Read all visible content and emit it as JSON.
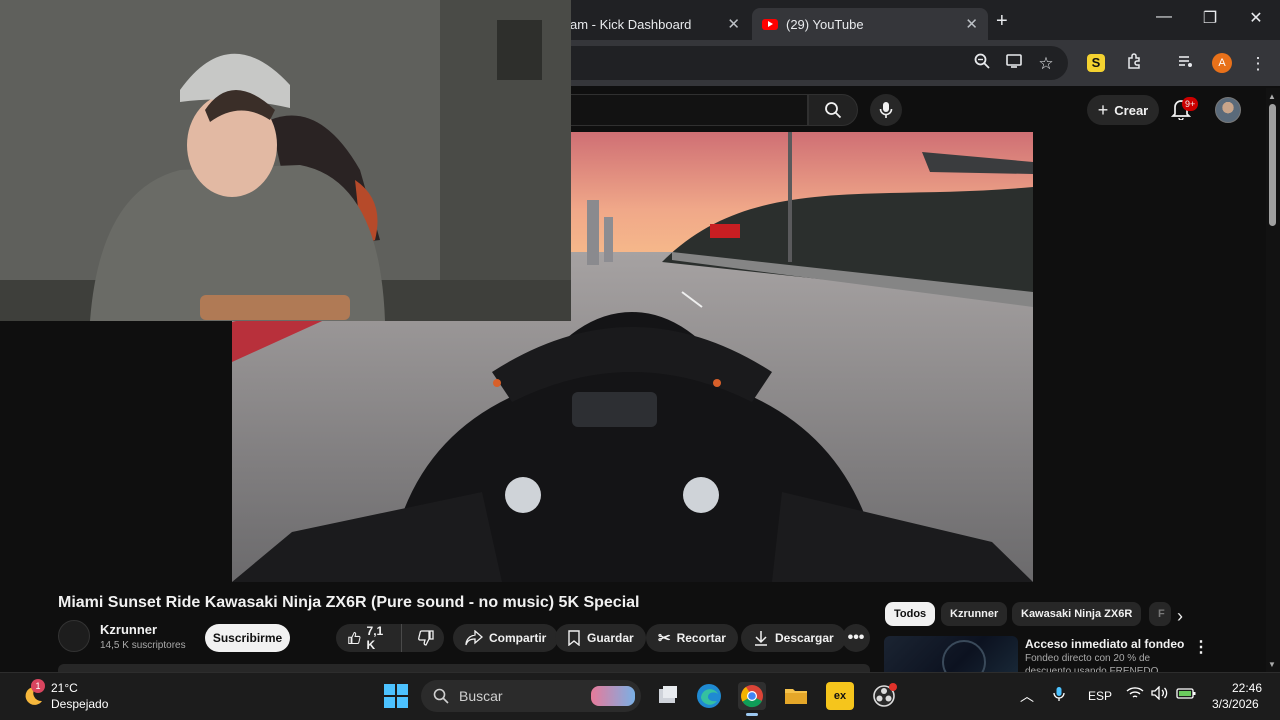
{
  "browser": {
    "tabs": [
      {
        "label": "am - Kick Dashboard"
      },
      {
        "label": "(29) YouTube"
      }
    ],
    "new_tab_icon": "plus-icon",
    "window_controls": [
      "minimize-icon",
      "restore-icon",
      "close-icon"
    ],
    "profile_initial": "A",
    "extension_badge": "S"
  },
  "youtube": {
    "create_label": "Crear",
    "notifications_badge": "9+",
    "video": {
      "title": "Miami Sunset Ride Kawasaki Ninja ZX6R (Pure sound - no music) 5K Special",
      "channel": "Kzrunner",
      "subscribers": "14,5 K suscriptores",
      "subscribe_label": "Suscribirme",
      "likes": "7,1 K",
      "actions": {
        "share": "Compartir",
        "save": "Guardar",
        "clip": "Recortar",
        "download": "Descargar"
      }
    },
    "chips": [
      "Todos",
      "Kzrunner",
      "Kawasaki Ninja ZX6R",
      "F"
    ],
    "recommendation": {
      "title": "Acceso inmediato al fondeo",
      "line1": "Fondeo directo con 20 % de",
      "line2": "descuento usando FRENEDO"
    }
  },
  "taskbar": {
    "weather": {
      "temp": "21°C",
      "desc": "Despejado",
      "badge": "1"
    },
    "search_placeholder": "Buscar",
    "language": "ESP",
    "time": "22:46",
    "date": "3/3/2026"
  },
  "colors": {
    "accent": "#ff0000",
    "chip_active": "#f1f1f1",
    "start_blue": "#4cc2ff"
  }
}
